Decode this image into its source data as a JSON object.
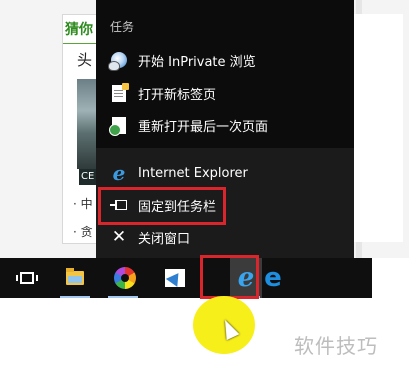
{
  "background_page": {
    "tab_label": "猜你",
    "headline": "头",
    "caption": "CE",
    "bullet1": "· 中",
    "bullet2": "· 贪"
  },
  "jump_list": {
    "section_title": "任务",
    "tasks": [
      {
        "label": "开始 InPrivate 浏览",
        "icon": "inprivate-icon"
      },
      {
        "label": "打开新标签页",
        "icon": "new-tab-icon"
      },
      {
        "label": "重新打开最后一次页面",
        "icon": "reopen-icon"
      }
    ],
    "app_name": "Internet Explorer",
    "pin_label": "固定到任务栏",
    "close_label": "关闭窗口"
  },
  "taskbar": {
    "icons": [
      "task-view-icon",
      "file-explorer-icon",
      "photos-icon",
      "feedback-icon",
      "internet-explorer-icon",
      "edge-icon"
    ],
    "active": "internet-explorer-icon"
  },
  "colors": {
    "highlight": "#d9262d",
    "accent": "#3c9be0",
    "spotlight": "#f7ef19"
  },
  "watermark": "软件技巧"
}
